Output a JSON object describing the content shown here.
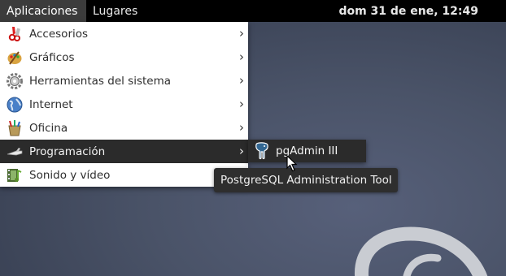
{
  "top_panel": {
    "applications_label": "Aplicaciones",
    "places_label": "Lugares",
    "clock": "dom 31 de ene, 12:49"
  },
  "applications_menu": {
    "items": [
      {
        "label": "Accesorios",
        "icon": "accessories-icon"
      },
      {
        "label": "Gráficos",
        "icon": "graphics-icon"
      },
      {
        "label": "Herramientas del sistema",
        "icon": "system-tools-icon"
      },
      {
        "label": "Internet",
        "icon": "internet-globe-icon"
      },
      {
        "label": "Oficina",
        "icon": "office-icon"
      },
      {
        "label": "Programación",
        "icon": "programming-icon",
        "selected": true
      },
      {
        "label": "Sonido y vídeo",
        "icon": "sound-video-icon"
      }
    ],
    "submenu_arrow": "›"
  },
  "submenu": {
    "items": [
      {
        "label": "pgAdmin III",
        "icon": "pgadmin-elephant-icon"
      }
    ]
  },
  "tooltip": {
    "text": "PostgreSQL Administration Tool"
  },
  "colors": {
    "panel_bg": "#000000",
    "menu_bg": "#ffffff",
    "selected_bg": "#2b2b2b",
    "desktop_bg": "#4a5368"
  }
}
